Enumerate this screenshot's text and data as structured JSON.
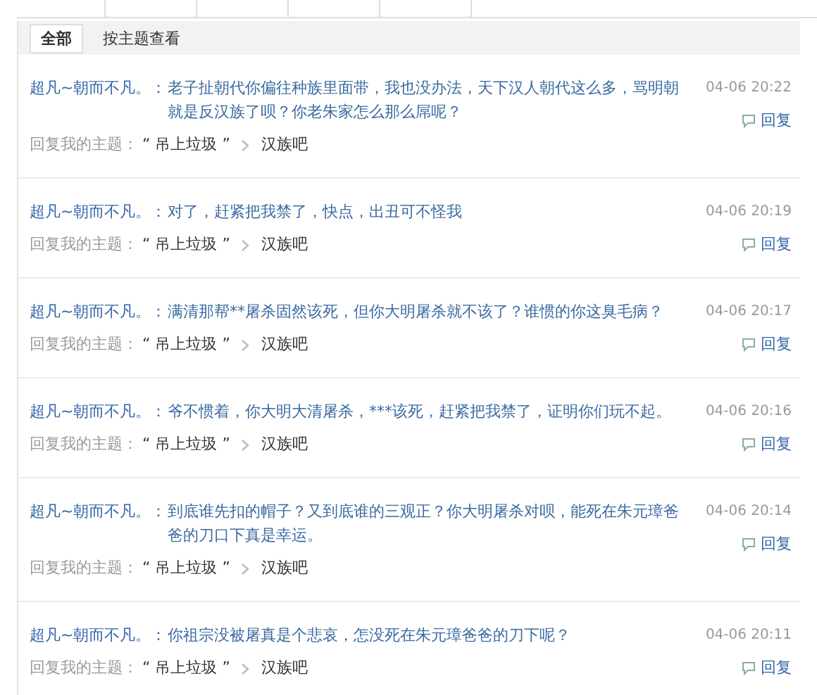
{
  "tabs": [
    {
      "label": "全部",
      "selected": true
    },
    {
      "label": "按主题查看",
      "selected": false
    }
  ],
  "posts": [
    {
      "user": "超凡~朝而不凡。：",
      "text": "老子扯朝代你偏往种族里面带，我也没办法，天下汉人朝代这么多，骂明朝就是反汉族了呗？你老朱家怎么那么屌呢？",
      "time": "04-06 20:22",
      "reply": "回复",
      "meta_prefix": "回复我的主题：",
      "topic": "“ 吊上垃圾 ”",
      "forum": "汉族吧"
    },
    {
      "user": "超凡~朝而不凡。：",
      "text": "对了，赶紧把我禁了，快点，出丑可不怪我",
      "time": "04-06 20:19",
      "reply": "回复",
      "meta_prefix": "回复我的主题：",
      "topic": "“ 吊上垃圾 ”",
      "forum": "汉族吧"
    },
    {
      "user": "超凡~朝而不凡。：",
      "text": "满清那帮**屠杀固然该死，但你大明屠杀就不该了？谁惯的你这臭毛病？",
      "time": "04-06 20:17",
      "reply": "回复",
      "meta_prefix": "回复我的主题：",
      "topic": "“ 吊上垃圾 ”",
      "forum": "汉族吧"
    },
    {
      "user": "超凡~朝而不凡。：",
      "text": "爷不惯着，你大明大清屠杀，***该死，赶紧把我禁了，证明你们玩不起。",
      "time": "04-06 20:16",
      "reply": "回复",
      "meta_prefix": "回复我的主题：",
      "topic": "“ 吊上垃圾 ”",
      "forum": "汉族吧"
    },
    {
      "user": "超凡~朝而不凡。：",
      "text": "到底谁先扣的帽子？又到底谁的三观正？你大明屠杀对呗，能死在朱元璋爸爸的刀口下真是幸运。",
      "time": "04-06 20:14",
      "reply": "回复",
      "meta_prefix": "回复我的主题：",
      "topic": "“ 吊上垃圾 ”",
      "forum": "汉族吧"
    },
    {
      "user": "超凡~朝而不凡。：",
      "text": "你祖宗没被屠真是个悲哀，怎没死在朱元璋爸爸的刀下呢？",
      "time": "04-06 20:11",
      "reply": "回复",
      "meta_prefix": "回复我的主题：",
      "topic": "“ 吊上垃圾 ”",
      "forum": "汉族吧"
    }
  ]
}
